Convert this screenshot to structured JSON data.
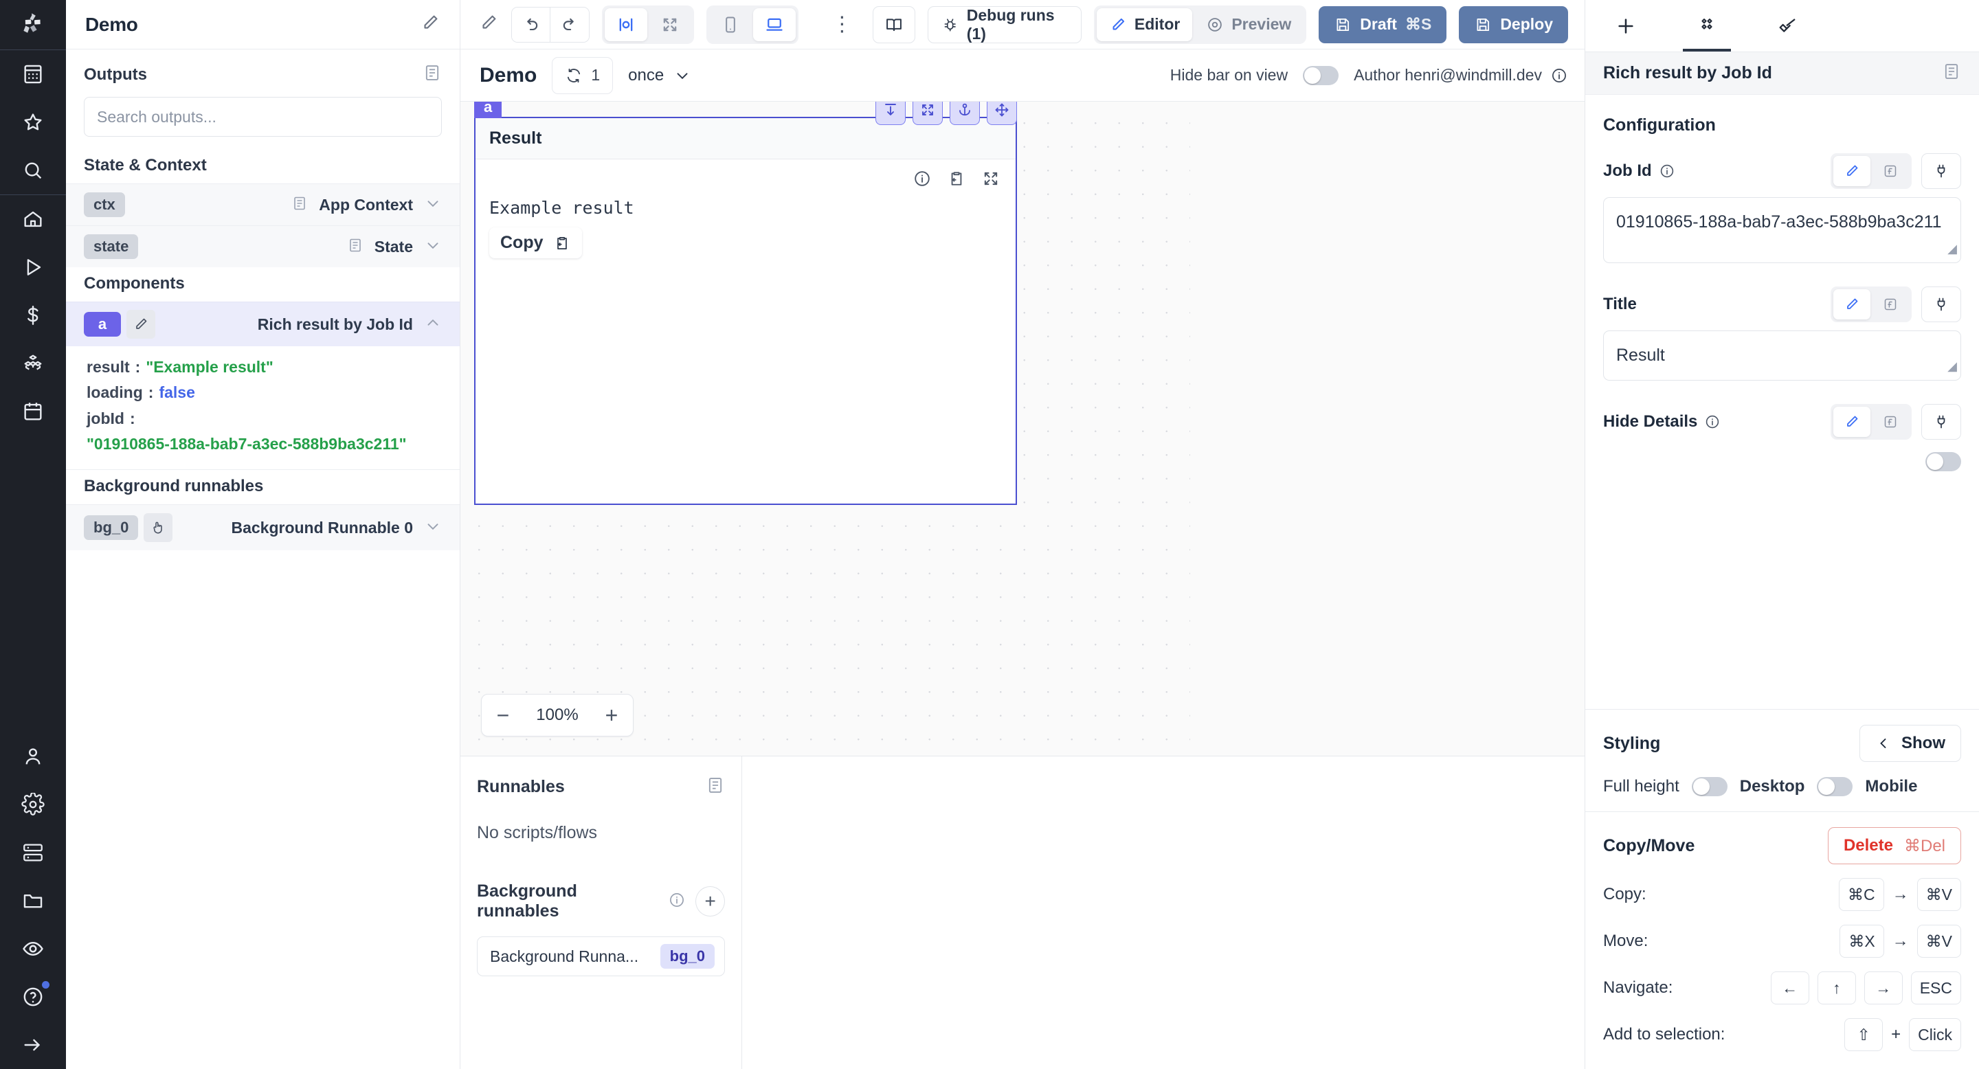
{
  "app": {
    "title": "Demo"
  },
  "nav": {
    "items": [
      {
        "name": "logo",
        "icon": "windmill-logo"
      },
      {
        "name": "workspace",
        "icon": "building-icon"
      },
      {
        "name": "favorites",
        "icon": "star-icon"
      },
      {
        "name": "search",
        "icon": "search-icon"
      },
      {
        "name": "home",
        "icon": "home-icon"
      },
      {
        "name": "runs",
        "icon": "play-icon"
      },
      {
        "name": "variables",
        "icon": "dollar-icon"
      },
      {
        "name": "resources",
        "icon": "cubes-icon"
      },
      {
        "name": "schedules",
        "icon": "calendar-icon"
      },
      {
        "name": "workers",
        "icon": "user-icon"
      },
      {
        "name": "settings",
        "icon": "gear-icon"
      },
      {
        "name": "workspace-admin",
        "icon": "server-icon"
      },
      {
        "name": "folders",
        "icon": "folder-icon"
      },
      {
        "name": "audit-logs",
        "icon": "eye-icon"
      },
      {
        "name": "help",
        "icon": "help-icon"
      },
      {
        "name": "expand",
        "icon": "arrow-right-icon"
      }
    ]
  },
  "outputs": {
    "header_title": "Demo",
    "panel_title": "Outputs",
    "search_placeholder": "Search outputs...",
    "state_context_label": "State & Context",
    "state_rows": [
      {
        "chip": "ctx",
        "name": "App Context"
      },
      {
        "chip": "state",
        "name": "State"
      }
    ],
    "components_label": "Components",
    "component": {
      "chip": "a",
      "name": "Rich result by Job Id",
      "fields": [
        {
          "key": "result",
          "value": "\"Example result\"",
          "type": "string"
        },
        {
          "key": "loading",
          "value": "false",
          "type": "bool"
        },
        {
          "key": "jobId",
          "value": "\"01910865-188a-bab7-a3ec-588b9ba3c211\"",
          "type": "string-wrap"
        }
      ]
    },
    "background_label": "Background runnables",
    "background_rows": [
      {
        "chip": "bg_0",
        "name": "Background Runnable 0"
      }
    ]
  },
  "toolbar": {
    "undo_icon": "undo-icon",
    "redo_icon": "redo-icon",
    "width_icon": "fixed-width-icon",
    "expand_icon": "expand-icon",
    "mobile_icon": "mobile-icon",
    "desktop_icon": "desktop-icon",
    "more_icon": "more-vertical-icon",
    "docs_label": "",
    "debug_runs_label": "Debug runs (1)",
    "editor_label": "Editor",
    "preview_label": "Preview",
    "draft_label": "Draft",
    "draft_kbd": "⌘S",
    "deploy_label": "Deploy"
  },
  "app_header": {
    "name": "Demo",
    "recompute_count": "1",
    "recompute_mode": "once",
    "hide_bar_label": "Hide bar on view",
    "hide_bar_on": false,
    "author_label": "Author henri@windmill.dev"
  },
  "canvas": {
    "component_tag": "a",
    "component_title": "Result",
    "result_text": "Example result",
    "copy_label": "Copy",
    "zoom_level": "100%",
    "handles": [
      "move-down-icon",
      "expand-icon",
      "anchor-icon",
      "move-icon"
    ]
  },
  "runnables": {
    "title": "Runnables",
    "empty": "No scripts/flows",
    "background_title": "Background runnables",
    "items": [
      {
        "name": "Background Runna...",
        "chip": "bg_0"
      }
    ]
  },
  "inspector": {
    "tabs": [
      {
        "name": "add",
        "icon": "plus-icon",
        "active": false
      },
      {
        "name": "component",
        "icon": "diamonds-icon",
        "active": true
      },
      {
        "name": "style",
        "icon": "brush-icon",
        "active": false
      }
    ],
    "component_title": "Rich result by Job Id",
    "configuration_label": "Configuration",
    "fields": [
      {
        "label": "Job Id",
        "has_info": true,
        "value": "01910865-188a-bab7-a3ec-588b9ba3c211",
        "kind": "textarea"
      },
      {
        "label": "Title",
        "has_info": false,
        "value": "Result",
        "kind": "textarea"
      },
      {
        "label": "Hide Details",
        "has_info": true,
        "value": "",
        "kind": "toggle",
        "toggle_on": false
      }
    ],
    "styling": {
      "title": "Styling",
      "show_label": "Show",
      "full_height_label": "Full height",
      "desktop_label": "Desktop",
      "mobile_label": "Mobile",
      "desktop_on": false,
      "mobile_on": false
    },
    "copymove": {
      "title": "Copy/Move",
      "delete_label": "Delete",
      "delete_kbd": "⌘Del",
      "rows": [
        {
          "label": "Copy:",
          "keys": [
            "⌘C",
            "→",
            "⌘V"
          ]
        },
        {
          "label": "Move:",
          "keys": [
            "⌘X",
            "→",
            "⌘V"
          ]
        },
        {
          "label": "Navigate:",
          "keys": [
            "←",
            "↑",
            "→",
            "ESC"
          ]
        },
        {
          "label": "Add to selection:",
          "keys": [
            "⇧",
            "+",
            "Click"
          ]
        }
      ]
    }
  },
  "colors": {
    "accent": "#6c63e8",
    "primary_btn": "#5d7aa9",
    "danger": "#e0332a",
    "string_green": "#25a04a",
    "bool_blue": "#4466e8"
  }
}
